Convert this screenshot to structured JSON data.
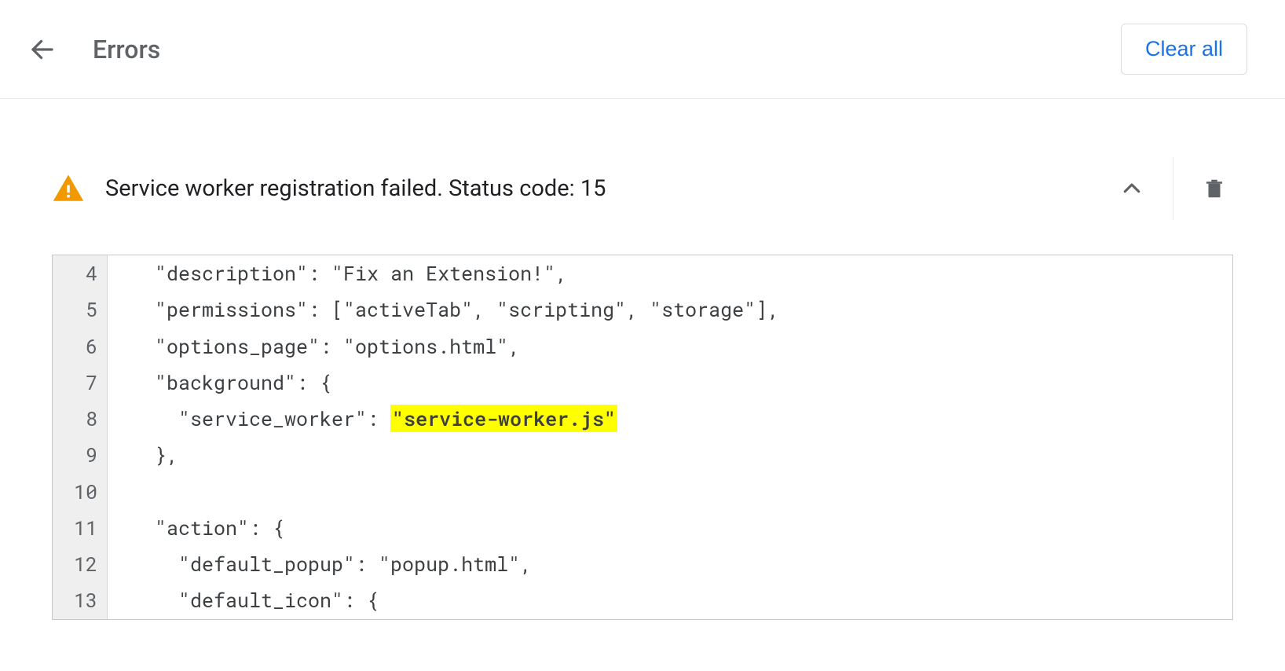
{
  "header": {
    "title": "Errors",
    "clear_all": "Clear all"
  },
  "error": {
    "message": "Service worker registration failed. Status code: 15"
  },
  "code": {
    "gutter": [
      "4",
      "5",
      "6",
      "7",
      "8",
      "9",
      "10",
      "11",
      "12",
      "13"
    ],
    "lines": [
      {
        "indent": "  ",
        "segs": [
          {
            "t": "\"description\": \"Fix an Extension!\","
          }
        ]
      },
      {
        "indent": "  ",
        "segs": [
          {
            "t": "\"permissions\": [\"activeTab\", \"scripting\", \"storage\"],"
          }
        ]
      },
      {
        "indent": "  ",
        "segs": [
          {
            "t": "\"options_page\": \"options.html\","
          }
        ]
      },
      {
        "indent": "  ",
        "segs": [
          {
            "t": "\"background\": {"
          }
        ]
      },
      {
        "indent": "    ",
        "segs": [
          {
            "t": "\"service_worker\": "
          },
          {
            "t": "\"service-worker.js\"",
            "hl": true
          }
        ]
      },
      {
        "indent": "  ",
        "segs": [
          {
            "t": "},"
          }
        ]
      },
      {
        "indent": "",
        "segs": [
          {
            "t": ""
          }
        ]
      },
      {
        "indent": "  ",
        "segs": [
          {
            "t": "\"action\": {"
          }
        ]
      },
      {
        "indent": "    ",
        "segs": [
          {
            "t": "\"default_popup\": \"popup.html\","
          }
        ]
      },
      {
        "indent": "    ",
        "segs": [
          {
            "t": "\"default_icon\": {"
          }
        ]
      }
    ]
  }
}
